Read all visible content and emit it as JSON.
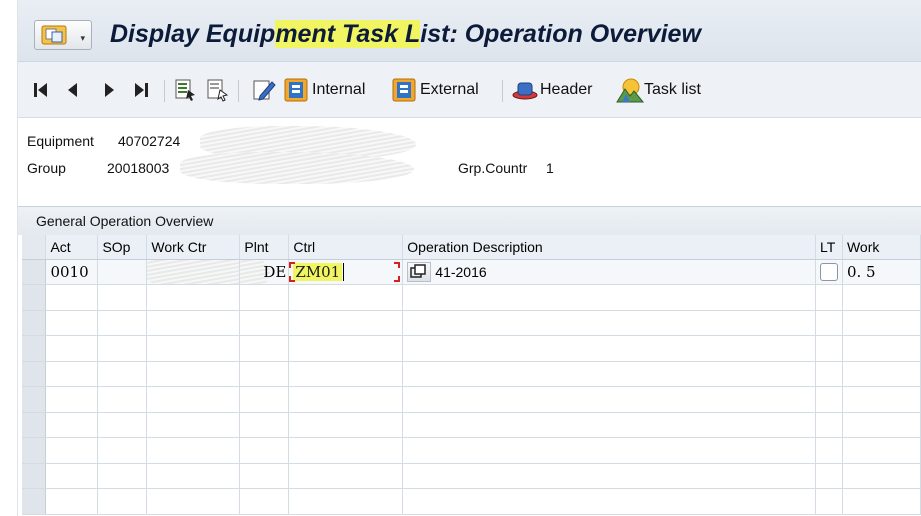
{
  "window": {
    "title_before": "Display Equip",
    "title_highlight": "ment Task L",
    "title_after": "ist: Operation Overview"
  },
  "toolbar": {
    "internal_label": "Internal",
    "external_label": "External",
    "header_label": "Header",
    "task_list_label": "Task list"
  },
  "header": {
    "equipment_label": "Equipment",
    "equipment_value": "40702724",
    "group_label": "Group",
    "group_value": "20018003",
    "grp_countr_label": "Grp.Countr",
    "grp_countr_value": "1"
  },
  "panel": {
    "title": "General Operation Overview",
    "columns": [
      "Act",
      "SOp",
      "Work Ctr",
      "Plnt",
      "Ctrl",
      "Operation Description",
      "LT",
      "Work"
    ],
    "rows": [
      {
        "act": "0010",
        "sop": "",
        "work_ctr": "",
        "plnt": "DE",
        "ctrl": "ZM01",
        "description": "41-2016",
        "work": "0. 5"
      }
    ]
  },
  "colors": {
    "highlight": "#f2f562",
    "title_text": "#0c1b3a",
    "bracket": "#d62020"
  }
}
